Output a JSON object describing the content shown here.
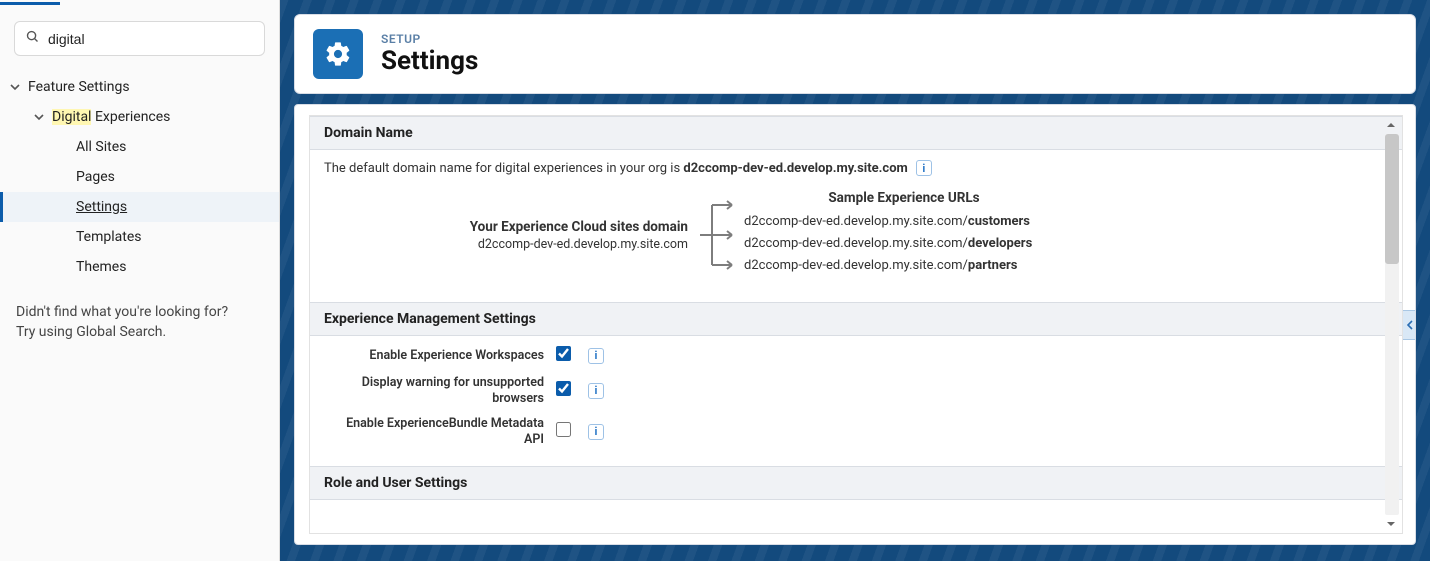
{
  "sidebar": {
    "search_value": "digital",
    "tree": {
      "root_label": "Feature Settings",
      "child": {
        "label_prefix_hl": "Digital",
        "label_rest": " Experiences",
        "items": [
          {
            "label": "All Sites"
          },
          {
            "label": "Pages"
          },
          {
            "label": "Settings",
            "active": true
          },
          {
            "label": "Templates"
          },
          {
            "label": "Themes"
          }
        ]
      }
    },
    "footer_line1": "Didn't find what you're looking for?",
    "footer_line2": "Try using Global Search."
  },
  "header": {
    "eyebrow": "SETUP",
    "title": "Settings"
  },
  "domain_section": {
    "title": "Domain Name",
    "description_prefix": "The default domain name for digital experiences in your org is ",
    "description_domain": "d2ccomp-dev-ed.develop.my.site.com",
    "left_label": "Your Experience Cloud sites domain",
    "left_domain": "d2ccomp-dev-ed.develop.my.site.com",
    "sample_header": "Sample Experience URLs",
    "sample_base": "d2ccomp-dev-ed.develop.my.site.com/",
    "samples": [
      {
        "bold": "customers"
      },
      {
        "bold": "developers"
      },
      {
        "bold": "partners"
      }
    ]
  },
  "experience_section": {
    "title": "Experience Management Settings",
    "rows": [
      {
        "label": "Enable Experience Workspaces",
        "checked": true
      },
      {
        "label": "Display warning for unsupported browsers",
        "checked": true
      },
      {
        "label": "Enable ExperienceBundle Metadata API",
        "checked": false
      }
    ]
  },
  "role_section": {
    "title": "Role and User Settings"
  }
}
